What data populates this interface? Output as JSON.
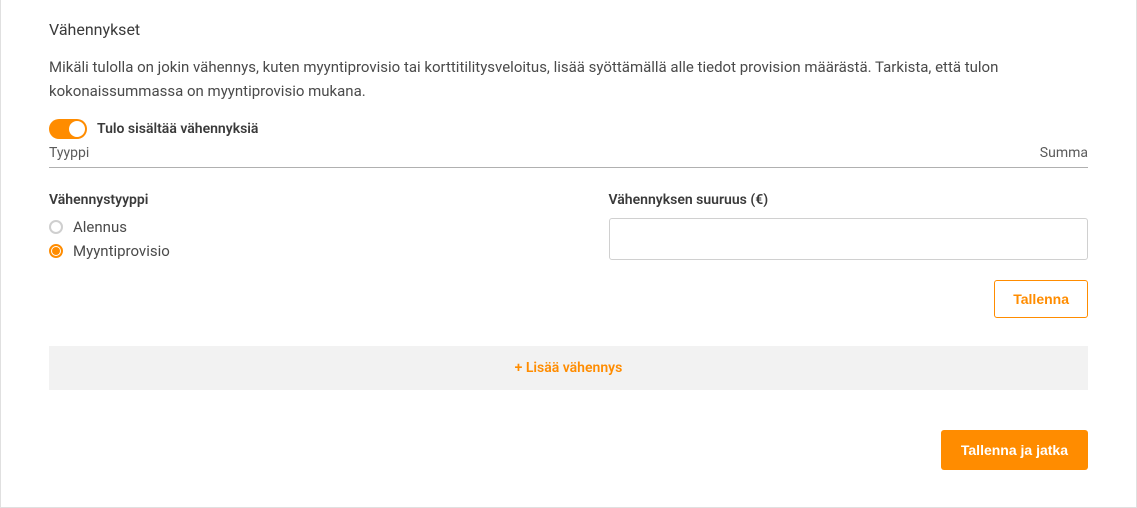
{
  "section": {
    "title": "Vähennykset",
    "description": "Mikäli tulolla on jokin vähennys, kuten myyntiprovisio tai korttitilitysveloitus, lisää syöttämällä alle tiedot provision määrästä. Tarkista, että tulon kokonaissummassa on myyntiprovisio mukana."
  },
  "toggle": {
    "label": "Tulo sisältää vähennyksiä",
    "on": true
  },
  "table": {
    "col_type": "Tyyppi",
    "col_sum": "Summa"
  },
  "form": {
    "type_label": "Vähennystyyppi",
    "radio": {
      "option_discount": "Alennus",
      "option_commission": "Myyntiprovisio",
      "selected": "commission"
    },
    "amount_label": "Vähennyksen suuruus (€)",
    "amount_value": ""
  },
  "buttons": {
    "save": "Tallenna",
    "add_deduction": "+ Lisää vähennys",
    "save_continue": "Tallenna ja jatka"
  }
}
